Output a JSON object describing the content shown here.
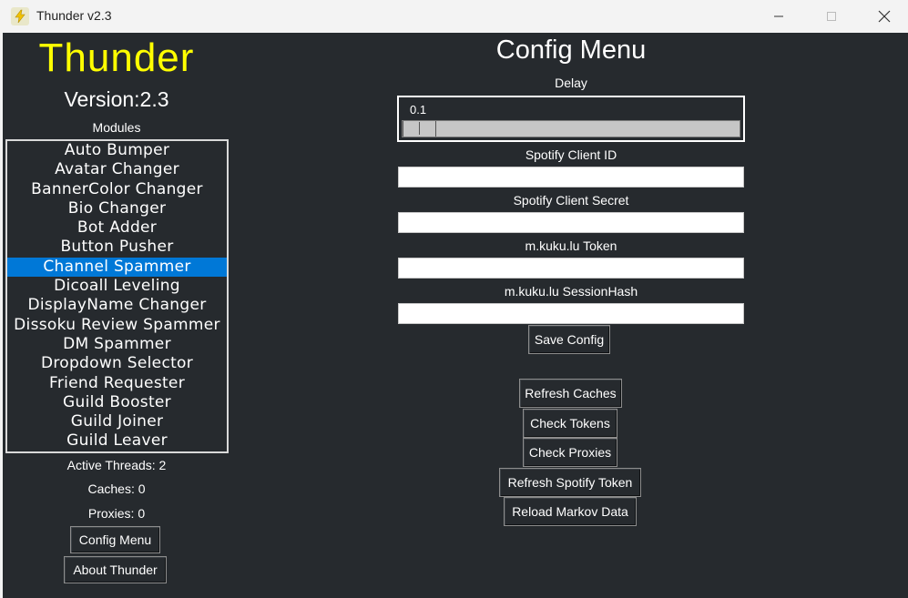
{
  "window": {
    "title": "Thunder v2.3",
    "icon": "thunder-app-icon",
    "controls": [
      "minimize-icon",
      "maximize-icon",
      "close-icon"
    ]
  },
  "sidebar": {
    "brand": "Thunder",
    "version": "Version:2.3",
    "modules_label": "Modules",
    "modules": [
      {
        "label": "Auto Bumper"
      },
      {
        "label": "Avatar Changer"
      },
      {
        "label": "BannerColor Changer"
      },
      {
        "label": "Bio Changer"
      },
      {
        "label": "Bot Adder"
      },
      {
        "label": "Button Pusher"
      },
      {
        "label": "Channel Spammer",
        "selected": true
      },
      {
        "label": "Dicoall Leveling"
      },
      {
        "label": "DisplayName Changer"
      },
      {
        "label": "Dissoku Review Spammer"
      },
      {
        "label": "DM Spammer"
      },
      {
        "label": "Dropdown Selector"
      },
      {
        "label": "Friend Requester"
      },
      {
        "label": "Guild Booster"
      },
      {
        "label": "Guild Joiner"
      },
      {
        "label": "Guild Leaver"
      }
    ],
    "stats": {
      "active_threads": "Active Threads: 2",
      "caches": "Caches: 0",
      "proxies": "Proxies: 0"
    },
    "buttons": {
      "config_menu": "Config Menu",
      "about": "About Thunder"
    }
  },
  "config": {
    "title": "Config Menu",
    "delay_label": "Delay",
    "delay_value": "0.1",
    "delay_fraction": 0.0,
    "fields": {
      "spotify_client_id_label": "Spotify Client ID",
      "spotify_client_id_value": "",
      "spotify_client_secret_label": "Spotify Client Secret",
      "spotify_client_secret_value": "",
      "kuku_token_label": "m.kuku.lu Token",
      "kuku_token_value": "",
      "kuku_sessionhash_label": "m.kuku.lu SessionHash",
      "kuku_sessionhash_value": ""
    },
    "save_label": "Save Config",
    "actions": {
      "refresh_caches": "Refresh Caches",
      "check_tokens": "Check Tokens",
      "check_proxies": "Check Proxies",
      "refresh_spotify_token": "Refresh Spotify Token",
      "reload_markov": "Reload Markov Data"
    }
  },
  "colors": {
    "background": "#262a2e",
    "brand": "#ffff00",
    "selection": "#0078d7"
  }
}
